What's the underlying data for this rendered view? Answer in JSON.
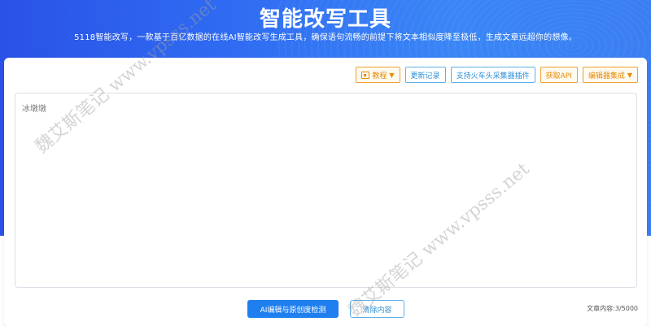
{
  "header": {
    "title": "智能改写工具",
    "subtitle": "5118智能改写，一款基于百亿数据的在线AI智能改写生成工具，确保语句流畅的前提下将文本相似度降至极低，生成文章远超你的想像。"
  },
  "toolbar": {
    "tutorial_label": "教程",
    "update_log_label": "更新记录",
    "locomotive_plugin_label": "支持火车头采集器插件",
    "get_api_label": "获取API",
    "editor_integration_label": "编辑器集成"
  },
  "editor": {
    "placeholder": "冰墩墩",
    "value": ""
  },
  "actions": {
    "detect_label": "AI编辑与原创度检测",
    "clear_label": "清除内容",
    "count_label": "文章内容:3/5000"
  },
  "watermark": {
    "text": "魏艾斯笔记 www.vpsss.net"
  },
  "colors": {
    "primary": "#1f7fef",
    "hero_start": "#2a52e6",
    "hero_end": "#3b7ef2",
    "orange": "#e68a00"
  }
}
